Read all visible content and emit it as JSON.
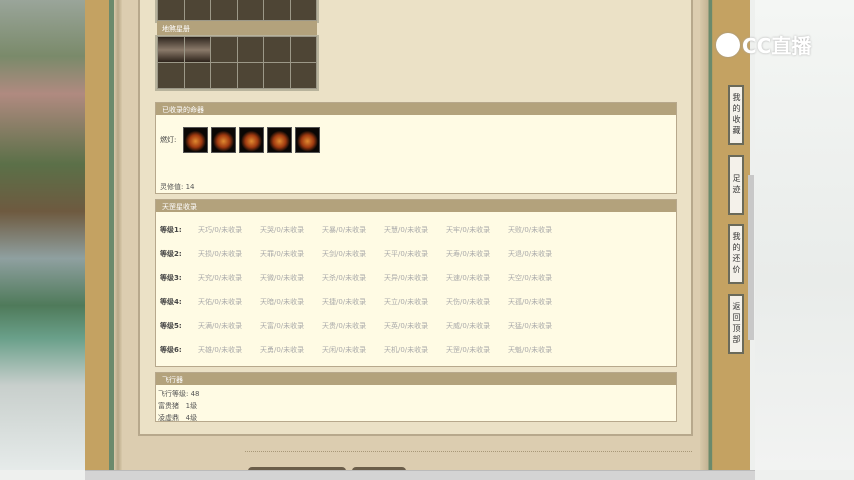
{
  "grid_title": "地煞星册",
  "artifacts": {
    "title": "已收录的命器",
    "row_label": "燃灯:",
    "spirit": "灵修值: 14",
    "icons": [
      "artifact-1",
      "artifact-2",
      "artifact-3",
      "artifact-4",
      "artifact-5"
    ]
  },
  "tiangang": {
    "title": "天罡星收录",
    "levels": [
      {
        "label": "等级1:",
        "items": [
          "天巧/0/未收录",
          "天哭/0/未收录",
          "天暴/0/未收录",
          "天慧/0/未收录",
          "天牢/0/未收录",
          "天败/0/未收录"
        ]
      },
      {
        "label": "等级2:",
        "items": [
          "天损/0/未收录",
          "天罪/0/未收录",
          "天剑/0/未收录",
          "天平/0/未收录",
          "天寿/0/未收录",
          "天退/0/未收录"
        ]
      },
      {
        "label": "等级3:",
        "items": [
          "天究/0/未收录",
          "天微/0/未收录",
          "天杀/0/未收录",
          "天异/0/未收录",
          "天速/0/未收录",
          "天空/0/未收录"
        ]
      },
      {
        "label": "等级4:",
        "items": [
          "天佑/0/未收录",
          "天暗/0/未收录",
          "天捷/0/未收录",
          "天立/0/未收录",
          "天伤/0/未收录",
          "天孤/0/未收录"
        ]
      },
      {
        "label": "等级5:",
        "items": [
          "天满/0/未收录",
          "天富/0/未收录",
          "天贵/0/未收录",
          "天英/0/未收录",
          "天威/0/未收录",
          "天猛/0/未收录"
        ]
      },
      {
        "label": "等级6:",
        "items": [
          "天雄/0/未收录",
          "天勇/0/未收录",
          "天闲/0/未收录",
          "天机/0/未收录",
          "天罡/0/未收录",
          "天魁/0/未收录"
        ]
      }
    ]
  },
  "flyer": {
    "title": "飞行器",
    "lines": [
      "飞行等级: 48",
      "富贵猪   1级",
      "凌虚鼎   4级"
    ]
  },
  "side": {
    "favorites": "我的收藏",
    "footprint": "足迹",
    "bargain": "我的还价",
    "top": "返回顶部"
  },
  "logo": "CC直播"
}
